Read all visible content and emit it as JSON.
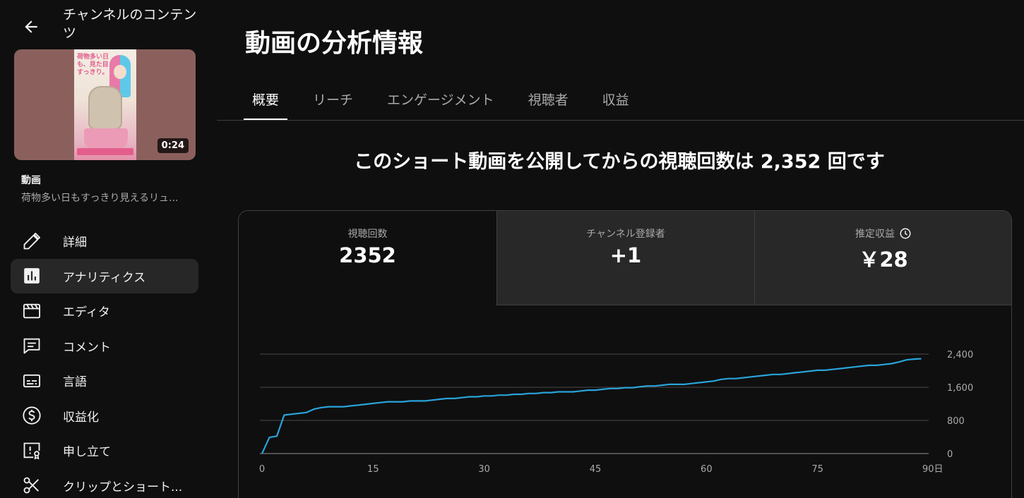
{
  "sidebar": {
    "title": "チャンネルのコンテンツ",
    "thumbnail": {
      "duration": "0:24",
      "poster_text": "荷物多い日も、見た目すっきり。"
    },
    "video_label": "動画",
    "video_title": "荷物多い日もすっきり見えるリュ...",
    "nav": [
      {
        "label": "詳細",
        "icon": "pencil-icon",
        "active": false
      },
      {
        "label": "アナリティクス",
        "icon": "analytics-icon",
        "active": true
      },
      {
        "label": "エディタ",
        "icon": "clapperboard-icon",
        "active": false
      },
      {
        "label": "コメント",
        "icon": "comment-icon",
        "active": false
      },
      {
        "label": "言語",
        "icon": "subtitles-icon",
        "active": false
      },
      {
        "label": "収益化",
        "icon": "dollar-icon",
        "active": false
      },
      {
        "label": "申し立て",
        "icon": "claim-icon",
        "active": false
      },
      {
        "label": "クリップとショート...",
        "icon": "scissors-icon",
        "active": false
      }
    ]
  },
  "main": {
    "title": "動画の分析情報",
    "tabs": [
      {
        "label": "概要",
        "active": true
      },
      {
        "label": "リーチ",
        "active": false
      },
      {
        "label": "エンゲージメント",
        "active": false
      },
      {
        "label": "視聴者",
        "active": false
      },
      {
        "label": "収益",
        "active": false
      }
    ],
    "headline": "このショート動画を公開してからの視聴回数は 2,352 回です",
    "metrics": [
      {
        "label": "視聴回数",
        "value": "2352"
      },
      {
        "label": "チャンネル登録者",
        "value": "+1"
      },
      {
        "label": "推定収益",
        "value": "￥28"
      }
    ]
  },
  "colors": {
    "background": "#0f0f0f",
    "accent_line": "#29a3d9",
    "active_nav": "#272727"
  },
  "chart_data": {
    "type": "line",
    "x_unit_label": "日",
    "x_ticks": [
      0,
      15,
      30,
      45,
      60,
      75,
      90
    ],
    "y_ticks": [
      0,
      800,
      1600,
      2400
    ],
    "ylim": [
      0,
      2400
    ],
    "xlim": [
      0,
      90
    ],
    "grid": true,
    "series": [
      {
        "color": "#29a3d9",
        "x": [
          0,
          1,
          2,
          3,
          4,
          5,
          6,
          7,
          8,
          9,
          10,
          11,
          12,
          13,
          14,
          15,
          16,
          17,
          18,
          19,
          20,
          21,
          22,
          23,
          24,
          25,
          26,
          27,
          28,
          29,
          30,
          31,
          32,
          33,
          34,
          35,
          36,
          37,
          38,
          39,
          40,
          41,
          42,
          43,
          44,
          45,
          46,
          47,
          48,
          49,
          50,
          51,
          52,
          53,
          54,
          55,
          56,
          57,
          58,
          59,
          60,
          61,
          62,
          63,
          64,
          65,
          66,
          67,
          68,
          69,
          70,
          71,
          72,
          73,
          74,
          75,
          76,
          77,
          78,
          79,
          80,
          81,
          82,
          83,
          84,
          85,
          86,
          87,
          88,
          89
        ],
        "values": [
          0,
          390,
          420,
          930,
          950,
          970,
          990,
          1070,
          1110,
          1130,
          1130,
          1130,
          1150,
          1170,
          1190,
          1210,
          1230,
          1250,
          1250,
          1250,
          1270,
          1270,
          1270,
          1290,
          1310,
          1330,
          1330,
          1350,
          1370,
          1370,
          1390,
          1390,
          1410,
          1410,
          1430,
          1430,
          1450,
          1450,
          1470,
          1470,
          1490,
          1490,
          1490,
          1510,
          1530,
          1530,
          1550,
          1570,
          1570,
          1590,
          1590,
          1610,
          1630,
          1630,
          1650,
          1670,
          1670,
          1670,
          1690,
          1710,
          1730,
          1750,
          1790,
          1810,
          1810,
          1830,
          1850,
          1870,
          1890,
          1910,
          1910,
          1930,
          1950,
          1970,
          1990,
          2010,
          2010,
          2030,
          2050,
          2070,
          2090,
          2110,
          2130,
          2130,
          2150,
          2170,
          2210,
          2260,
          2280,
          2290
        ]
      }
    ]
  }
}
